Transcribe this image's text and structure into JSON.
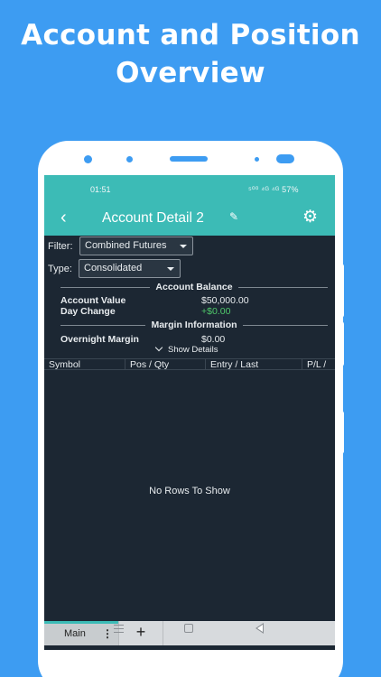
{
  "headline": {
    "line1": "Account and Position",
    "line2": "Overview"
  },
  "status_bar": {
    "time": "01:51",
    "icons_text": "⁵⁰⁰ ⁴ᴳ ⁴ᴳ 57%",
    "battery": "57%"
  },
  "app_bar": {
    "back_icon": "‹",
    "title": "Account Detail 2",
    "edit_icon": "✎",
    "settings_icon": "⚙"
  },
  "filter": {
    "label": "Filter:",
    "value": "Combined Futures"
  },
  "type": {
    "label": "Type:",
    "value": "Consolidated"
  },
  "account_balance": {
    "heading": "Account Balance",
    "account_value_label": "Account Value",
    "account_value": "$50,000.00",
    "day_change_label": "Day Change",
    "day_change": "+$0.00"
  },
  "margin": {
    "heading": "Margin Information",
    "overnight_label": "Overnight Margin",
    "overnight_value": "$0.00"
  },
  "show_details": "Show Details",
  "grid": {
    "columns": [
      "Symbol",
      "Pos / Qty",
      "Entry / Last",
      "P/L /"
    ],
    "empty_message": "No Rows To Show"
  },
  "tabs": {
    "main_label": "Main",
    "menu_icon": "⋮",
    "add_icon": "+"
  },
  "colors": {
    "background": "#3d9cf2",
    "accent": "#3cbbb6",
    "screen": "#1c2733",
    "positive": "#4fc86a"
  }
}
